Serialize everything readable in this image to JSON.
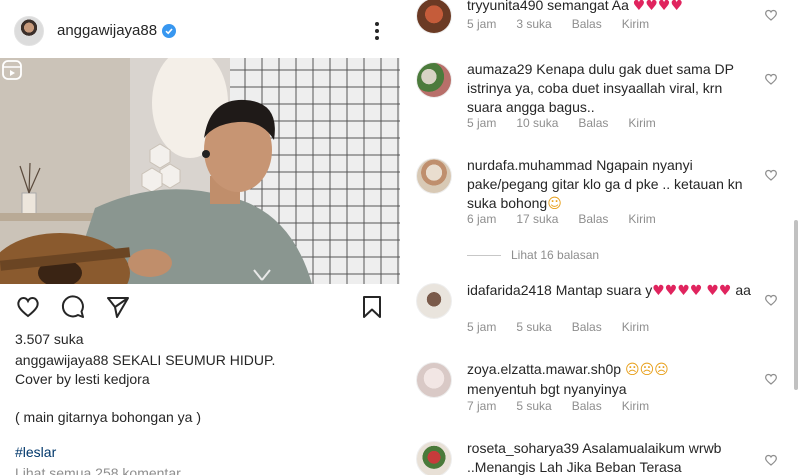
{
  "post": {
    "username": "anggawijaya88",
    "likes": "3.507 suka",
    "caption_user": "anggawijaya88",
    "caption_line1": "SEKALI SEUMUR HIDUP.",
    "caption_line2": "Cover by lesti kedjora",
    "caption_line3": "( main gitarnya bohongan ya )",
    "hashtag": "#leslar",
    "view_all_comments": "Lihat semua 258 komentar"
  },
  "colors": {
    "verified": "#3897f0",
    "link": "#00376b",
    "meta": "#8e8e8e",
    "heart": "#e0245e"
  },
  "comments": [
    {
      "user": "tryyunita490",
      "text": "semangat Aa",
      "emoji": "♥♥♥♥",
      "time": "5 jam",
      "likes": "3 suka",
      "reply": "Balas",
      "send": "Kirim"
    },
    {
      "user": "aumaza29",
      "text": "Kenapa dulu gak duet sama DP istrinya ya, coba duet insyaallah viral, krn suara angga bagus..",
      "time": "5 jam",
      "likes": "10 suka",
      "reply": "Balas",
      "send": "Kirim"
    },
    {
      "user": "nurdafa.muhammad",
      "text": "Ngapain nyanyi pake/pegang gitar klo ga d pke .. ketauan kn suka bohong",
      "emoji": "☺",
      "time": "6 jam",
      "likes": "17 suka",
      "reply": "Balas",
      "send": "Kirim",
      "view_replies": "Lihat 16 balasan"
    },
    {
      "user": "idafarida2418",
      "text": "Mantap suara y",
      "emoji_a": "♥♥♥♥",
      "emoji_b": "♥♥",
      "text2": "aa",
      "time": "5 jam",
      "likes": "5 suka",
      "reply": "Balas",
      "send": "Kirim"
    },
    {
      "user": "zoya.elzatta.mawar.sh0p",
      "emoji": "☹☹☹",
      "text": "menyentuh bgt nyanyinya",
      "time": "7 jam",
      "likes": "5 suka",
      "reply": "Balas",
      "send": "Kirim"
    },
    {
      "user": "roseta_soharya39",
      "text": "Asalamualaikum wrwb ..Menangis Lah Jika Beban Terasa"
    }
  ]
}
